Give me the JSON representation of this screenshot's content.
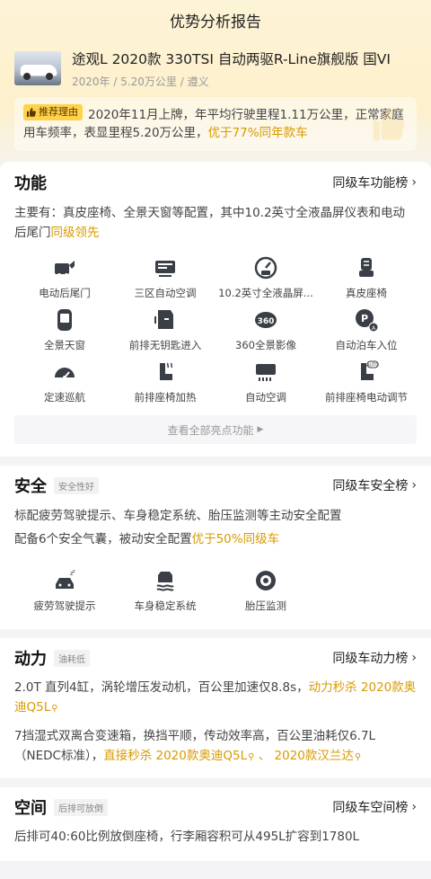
{
  "header": {
    "title": "优势分析报告"
  },
  "car": {
    "name": "途观L 2020款 330TSI 自动两驱R-Line旗舰版 国VI",
    "meta": "2020年 / 5.20万公里 / 遵义"
  },
  "reason": {
    "tag": "推荐理由",
    "text": "2020年11月上牌，年平均行驶里程1.11万公里，正常家庭用车频率，表显里程5.20万公里，",
    "highlight": "优于77%同年款车"
  },
  "features": {
    "title": "功能",
    "rank_link": "同级车功能榜",
    "desc": "主要有：真皮座椅、全景天窗等配置，其中10.2英寸全液晶屏仪表和电动后尾门",
    "desc_hl": "同级领先",
    "items": [
      {
        "label": "电动后尾门",
        "icon": "tailgate-icon"
      },
      {
        "label": "三区自动空调",
        "icon": "climate-icon"
      },
      {
        "label": "10.2英寸全液晶屏...",
        "icon": "lcd-dashboard-icon"
      },
      {
        "label": "真皮座椅",
        "icon": "leather-seat-icon"
      },
      {
        "label": "全景天窗",
        "icon": "sunroof-icon"
      },
      {
        "label": "前排无钥匙进入",
        "icon": "keyless-entry-icon"
      },
      {
        "label": "360全景影像",
        "icon": "camera-360-icon"
      },
      {
        "label": "自动泊车入位",
        "icon": "auto-parking-icon"
      },
      {
        "label": "定速巡航",
        "icon": "cruise-control-icon"
      },
      {
        "label": "前排座椅加热",
        "icon": "seat-heating-icon"
      },
      {
        "label": "自动空调",
        "icon": "auto-ac-icon"
      },
      {
        "label": "前排座椅电动调节",
        "icon": "power-seat-icon"
      }
    ],
    "view_all": "查看全部亮点功能"
  },
  "safety": {
    "title": "安全",
    "badge": "安全性好",
    "rank_link": "同级车安全榜",
    "desc1": "标配疲劳驾驶提示、车身稳定系统、胎压监测等主动安全配置",
    "desc2": "配备6个安全气囊，被动安全配置",
    "desc2_hl": "优于50%同级车",
    "items": [
      {
        "label": "疲劳驾驶提示",
        "icon": "fatigue-alert-icon"
      },
      {
        "label": "车身稳定系统",
        "icon": "stability-control-icon"
      },
      {
        "label": "胎压监测",
        "icon": "tire-pressure-icon"
      }
    ]
  },
  "power": {
    "title": "动力",
    "badge": "油耗低",
    "rank_link": "同级车动力榜",
    "desc1": "2.0T 直列4缸，涡轮增压发动机，百公里加速仅8.8s，",
    "desc1_hl": "动力秒杀 2020款奥迪Q5L",
    "desc2": "7挡湿式双离合变速箱，换挡平顺，传动效率高，百公里油耗仅6.7L（NEDC标准），",
    "desc2_hl1": "直接秒杀 2020款奥迪Q5L",
    "desc2_sep": " 、 ",
    "desc2_hl2": "2020款汉兰达"
  },
  "space": {
    "title": "空间",
    "badge": "后排可放倒",
    "rank_link": "同级车空间榜",
    "desc": "后排可40:60比例放倒座椅，行李厢容积可从495L扩容到1780L"
  }
}
